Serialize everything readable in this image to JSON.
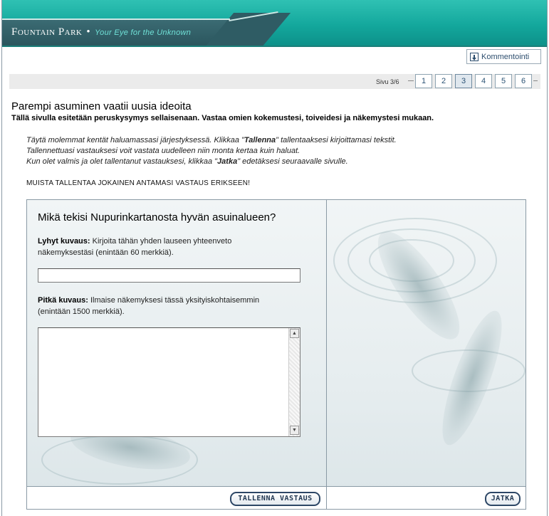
{
  "header": {
    "brand": "Fountain Park",
    "tagline": "Your Eye for the Unknown"
  },
  "toolbar": {
    "comment_label": "Kommentointi"
  },
  "pager": {
    "label": "Sivu 3/6",
    "pages": [
      "1",
      "2",
      "3",
      "4",
      "5",
      "6"
    ],
    "current": "3"
  },
  "page": {
    "title": "Parempi asuminen vaatii uusia ideoita",
    "subtitle": "Tällä sivulla esitetään peruskysymys sellaisenaan. Vastaa omien kokemustesi, toiveidesi ja näkemystesi mukaan.",
    "instructions": {
      "line1_pre": "Täytä molemmat kentät haluamassasi järjestyksessä. Klikkaa \"",
      "line1_bold": "Tallenna",
      "line1_post": "\" tallentaaksesi kirjoittamasi tekstit.",
      "line2": "Tallennettuasi vastauksesi voit vastata uudelleen niin monta kertaa kuin haluat.",
      "line3_pre": "Kun olet valmis ja olet tallentanut vastauksesi, klikkaa \"",
      "line3_bold": "Jatka",
      "line3_post": "\" edetäksesi seuraavalle sivulle."
    },
    "reminder": "MUISTA TALLENTAA JOKAINEN ANTAMASI VASTAUS ERIKSEEN!"
  },
  "form": {
    "question": "Mikä tekisi Nupurinkartanosta hyvän asuinalueen?",
    "short": {
      "label_bold": "Lyhyt kuvaus:",
      "label_text": " Kirjoita tähän yhden lauseen yhteenveto näkemyksestäsi (enintään 60 merkkiä).",
      "value": ""
    },
    "long": {
      "label_bold": "Pitkä kuvaus:",
      "label_text": " Ilmaise näkemyksesi tässä yksityiskohtaisemmin (enintään 1500 merkkiä).",
      "value": ""
    },
    "save_label": "TALLENNA VASTAUS",
    "continue_label": "JATKA"
  }
}
